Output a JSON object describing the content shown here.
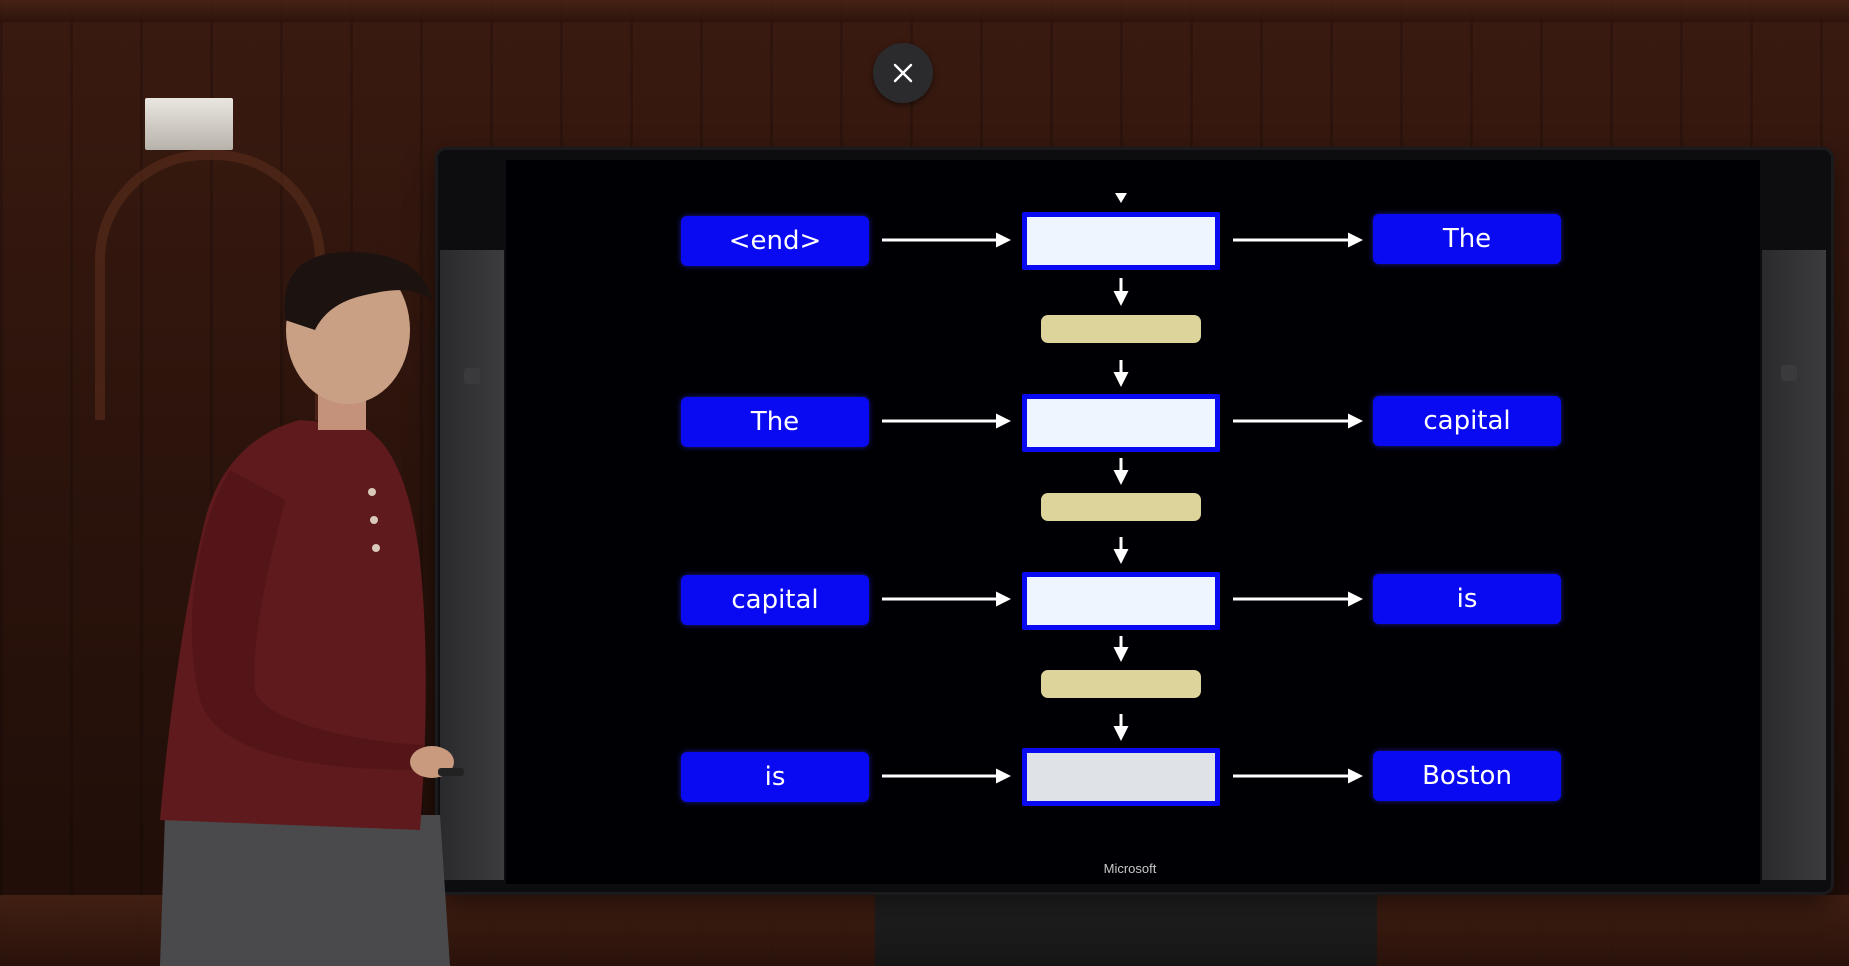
{
  "overlay": {
    "close_icon": "close-icon"
  },
  "display": {
    "brand_label": "Microsoft"
  },
  "diagram": {
    "inputs": [
      "<end>",
      "The",
      "capital",
      "is"
    ],
    "outputs": [
      "The",
      "capital",
      "is",
      "Boston"
    ],
    "colors": {
      "word_box": "#0a0af2",
      "state_box": "#eef5ff",
      "gate_box": "#dcd49a",
      "arrow": "#ffffff"
    }
  }
}
